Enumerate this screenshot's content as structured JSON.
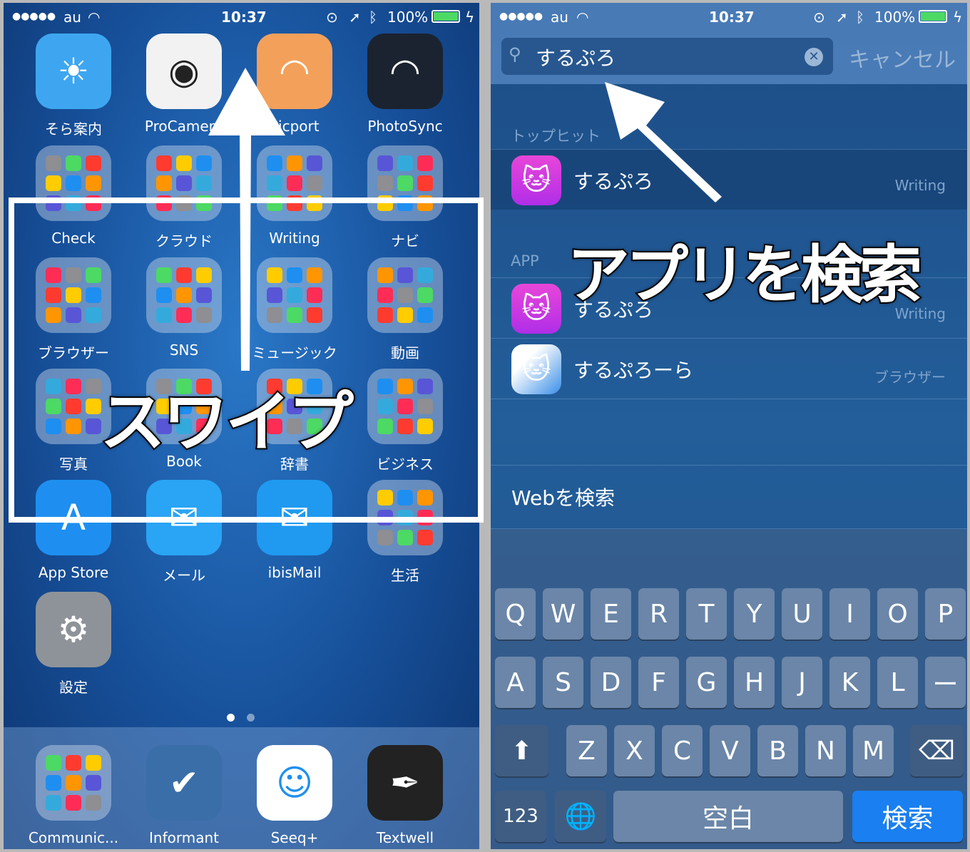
{
  "status": {
    "carrier": "au",
    "signal": "●●●●●",
    "time": "10:37",
    "battery": "100%",
    "battery_color": "#4cd964"
  },
  "home": {
    "apps": [
      {
        "label": "そら案内",
        "type": "app",
        "glyph": "☀",
        "bg": "#3ea6f0"
      },
      {
        "label": "ProCamera",
        "type": "app",
        "glyph": "◉",
        "bg": "#f2f2f2",
        "fg": "#222"
      },
      {
        "label": "Picport",
        "type": "app",
        "glyph": "◠",
        "bg": "#f3a05a"
      },
      {
        "label": "PhotoSync",
        "type": "app",
        "glyph": "◠",
        "bg": "#1b2330"
      },
      {
        "label": "Check",
        "type": "folder"
      },
      {
        "label": "クラウド",
        "type": "folder"
      },
      {
        "label": "Writing",
        "type": "folder"
      },
      {
        "label": "ナビ",
        "type": "folder"
      },
      {
        "label": "ブラウザー",
        "type": "folder"
      },
      {
        "label": "SNS",
        "type": "folder"
      },
      {
        "label": "ミュージック",
        "type": "folder"
      },
      {
        "label": "動画",
        "type": "folder"
      },
      {
        "label": "写真",
        "type": "folder"
      },
      {
        "label": "Book",
        "type": "folder"
      },
      {
        "label": "辞書",
        "type": "folder"
      },
      {
        "label": "ビジネス",
        "type": "folder"
      },
      {
        "label": "App Store",
        "type": "app",
        "glyph": "A",
        "bg": "#1e8ff0"
      },
      {
        "label": "メール",
        "type": "app",
        "glyph": "✉",
        "bg": "#2aa4f4"
      },
      {
        "label": "ibisMail",
        "type": "app",
        "glyph": "✉",
        "bg": "#1f9af0"
      },
      {
        "label": "生活",
        "type": "folder"
      },
      {
        "label": "設定",
        "type": "app",
        "glyph": "⚙",
        "bg": "#8e9399"
      }
    ],
    "dock": [
      {
        "label": "Communic...",
        "type": "folder"
      },
      {
        "label": "Informant",
        "type": "app",
        "glyph": "✔",
        "bg": "#3a6ea8"
      },
      {
        "label": "Seeq+",
        "type": "app",
        "glyph": "☺",
        "bg": "#ffffff",
        "fg": "#1e8ff0"
      },
      {
        "label": "Textwell",
        "type": "app",
        "glyph": "✒",
        "bg": "#222"
      }
    ],
    "overlay_text": "スワイプ"
  },
  "search": {
    "query": "するぷろ",
    "cancel": "キャンセル",
    "top_hit_header": "トップヒット",
    "top_hit": {
      "name": "するぷろ",
      "category": "Writing"
    },
    "app_header": "APP",
    "results": [
      {
        "name": "するぷろ",
        "category": "Writing"
      },
      {
        "name": "するぷろーら",
        "category": "ブラウザー"
      }
    ],
    "web_search": "Webを検索",
    "overlay_text": "アプリを検索"
  },
  "keyboard": {
    "row1": [
      "Q",
      "W",
      "E",
      "R",
      "T",
      "Y",
      "U",
      "I",
      "O",
      "P"
    ],
    "row2": [
      "A",
      "S",
      "D",
      "F",
      "G",
      "H",
      "J",
      "K",
      "L",
      "ー"
    ],
    "row3": [
      "Z",
      "X",
      "C",
      "V",
      "B",
      "N",
      "M"
    ],
    "numbers": "123",
    "space": "空白",
    "search": "検索",
    "search_color": "#1a7ff0"
  }
}
